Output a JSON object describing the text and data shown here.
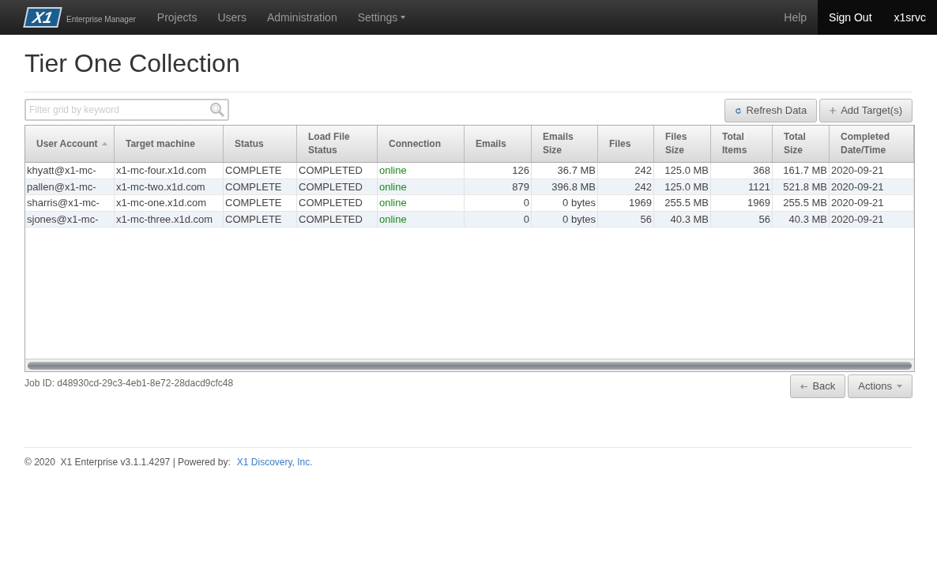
{
  "navbar": {
    "logo": "X1",
    "product": "Enterprise Manager",
    "menu": [
      {
        "label": "Projects",
        "dropdown": false
      },
      {
        "label": "Users",
        "dropdown": false
      },
      {
        "label": "Administration",
        "dropdown": false
      },
      {
        "label": "Settings",
        "dropdown": true
      }
    ],
    "right": [
      {
        "label": "Help",
        "highlighted": false
      },
      {
        "label": "Sign Out",
        "highlighted": true
      },
      {
        "label": "x1srvc",
        "highlighted": true
      }
    ]
  },
  "title": "Tier One Collection",
  "filter": {
    "placeholder": "Filter grid by keyword"
  },
  "toolbar": [
    {
      "label": "Refresh Data",
      "kind": "refresh"
    },
    {
      "label": "Add Target(s)",
      "kind": "add"
    }
  ],
  "table": {
    "columns": [
      {
        "label": "User Account",
        "sorted": true
      },
      {
        "label": "Target machine",
        "sorted": false
      },
      {
        "label": "Status",
        "sorted": false
      },
      {
        "label": "Load File Status",
        "sorted": false
      },
      {
        "label": "Connection",
        "sorted": false
      },
      {
        "label": "Emails",
        "sorted": false
      },
      {
        "label": "Emails Size",
        "sorted": false
      },
      {
        "label": "Files",
        "sorted": false
      },
      {
        "label": "Files Size",
        "sorted": false
      },
      {
        "label": "Total Items",
        "sorted": false
      },
      {
        "label": "Total Size",
        "sorted": false
      },
      {
        "label": "Completed Date/Time",
        "sorted": false
      }
    ],
    "rows": [
      [
        "khyatt@x1-mc-",
        "x1-mc-four.x1d.com",
        "COMPLETE",
        "COMPLETED",
        "online",
        "126",
        "36.7 MB",
        "242",
        "125.0 MB",
        "368",
        "161.7 MB",
        "2020-09-21"
      ],
      [
        "pallen@x1-mc-",
        "x1-mc-two.x1d.com",
        "COMPLETE",
        "COMPLETED",
        "online",
        "879",
        "396.8 MB",
        "242",
        "125.0 MB",
        "1121",
        "521.8 MB",
        "2020-09-21"
      ],
      [
        "sharris@x1-mc-",
        "x1-mc-one.x1d.com",
        "COMPLETE",
        "COMPLETED",
        "online",
        "0",
        "0 bytes",
        "1969",
        "255.5 MB",
        "1969",
        "255.5 MB",
        "2020-09-21"
      ],
      [
        "sjones@x1-mc-",
        "x1-mc-three.x1d.com",
        "COMPLETE",
        "COMPLETED",
        "online",
        "0",
        "0 bytes",
        "56",
        "40.3 MB",
        "56",
        "40.3 MB",
        "2020-09-21"
      ]
    ]
  },
  "job_id": "Job ID: d48930cd-29c3-4eb1-8e72-28dacd9cfc48",
  "actions": [
    {
      "label": "Back",
      "kind": "back"
    },
    {
      "label": "Actions",
      "kind": "menu"
    }
  ],
  "footer": {
    "text": "© 2020  X1 Enterprise v3.1.1.4297 | Powered by:",
    "link": "X1 Discovery, Inc."
  }
}
